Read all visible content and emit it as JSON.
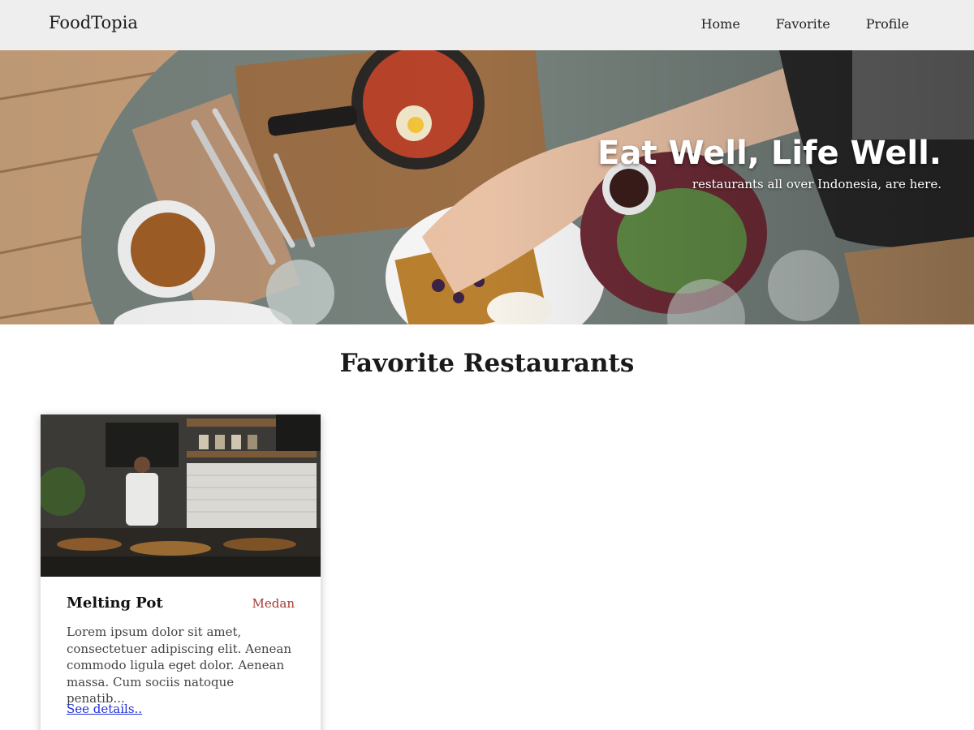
{
  "header": {
    "brand": "FoodTopia",
    "nav": [
      {
        "label": "Home"
      },
      {
        "label": "Favorite"
      },
      {
        "label": "Profile"
      }
    ]
  },
  "hero": {
    "title": "Eat Well, Life Well.",
    "subtitle": "restaurants all over Indonesia, are here."
  },
  "main": {
    "section_title": "Favorite Restaurants",
    "restaurants": [
      {
        "name": "Melting Pot",
        "city": "Medan",
        "description": "Lorem ipsum dolor sit amet, consectetuer adipiscing elit. Aenean commodo ligula eget dolor. Aenean massa. Cum sociis natoque penatib...",
        "link_label": "See details.."
      }
    ]
  },
  "colors": {
    "header_bg": "#eeeeee",
    "city_text": "#a63a32",
    "link": "#1f2fd6"
  }
}
